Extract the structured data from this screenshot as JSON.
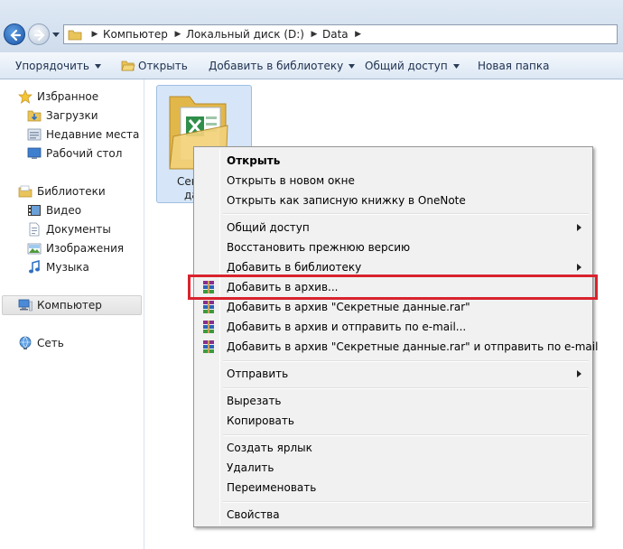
{
  "address_bar": {
    "crumbs": [
      "Компьютер",
      "Локальный диск (D:)",
      "Data"
    ]
  },
  "toolbar": {
    "organize": "Упорядочить",
    "open": "Открыть",
    "add_to_library": "Добавить в библиотеку",
    "share": "Общий доступ",
    "new_folder": "Новая папка"
  },
  "nav": {
    "favorites": "Избранное",
    "downloads": "Загрузки",
    "recent": "Недавние места",
    "desktop": "Рабочий стол",
    "libraries": "Библиотеки",
    "video": "Видео",
    "documents": "Документы",
    "images": "Изображения",
    "music": "Музыка",
    "computer": "Компьютер",
    "network": "Сеть"
  },
  "file": {
    "label_line1": "Сек",
    "label_line2": "да"
  },
  "context_menu": {
    "open": "Открыть",
    "open_new_window": "Открыть в новом окне",
    "open_onenote": "Открыть как записную книжку в OneNote",
    "share": "Общий доступ",
    "restore": "Восстановить прежнюю версию",
    "add_library": "Добавить в библиотеку",
    "add_archive": "Добавить в архив...",
    "add_archive_named": "Добавить в архив \"Секретные данные.rar\"",
    "add_archive_email": "Добавить в архив и отправить по e-mail...",
    "add_archive_named_email": "Добавить в архив \"Секретные данные.rar\" и отправить по e-mail",
    "send_to": "Отправить",
    "cut": "Вырезать",
    "copy": "Копировать",
    "shortcut": "Создать ярлык",
    "delete": "Удалить",
    "rename": "Переименовать",
    "properties": "Свойства"
  },
  "colors": {
    "highlight_border": "#d9232e",
    "toolbar_text": "#1e3150"
  }
}
